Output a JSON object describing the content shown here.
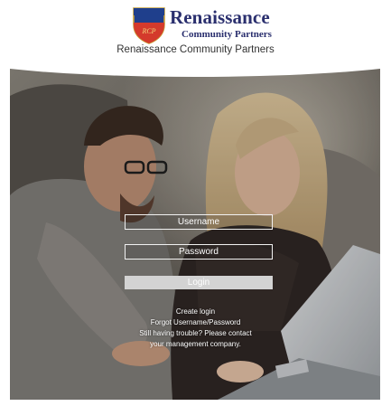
{
  "header": {
    "logo_name": "Renaissance",
    "logo_sub": "Community Partners",
    "site_title": "Renaissance Community Partners",
    "logo_initials": "RCP"
  },
  "login": {
    "username_placeholder": "Username",
    "password_placeholder": "Password",
    "login_label": "Login",
    "create_login": "Create login",
    "forgot": "Forgot Username/Password",
    "help_line1": "Still having trouble? Please contact",
    "help_line2": "your management company."
  },
  "colors": {
    "brand_navy": "#2a2f6e",
    "shield_red": "#d43a2c",
    "shield_blue": "#1f3f8c",
    "button_gray": "#d3d3d3"
  }
}
